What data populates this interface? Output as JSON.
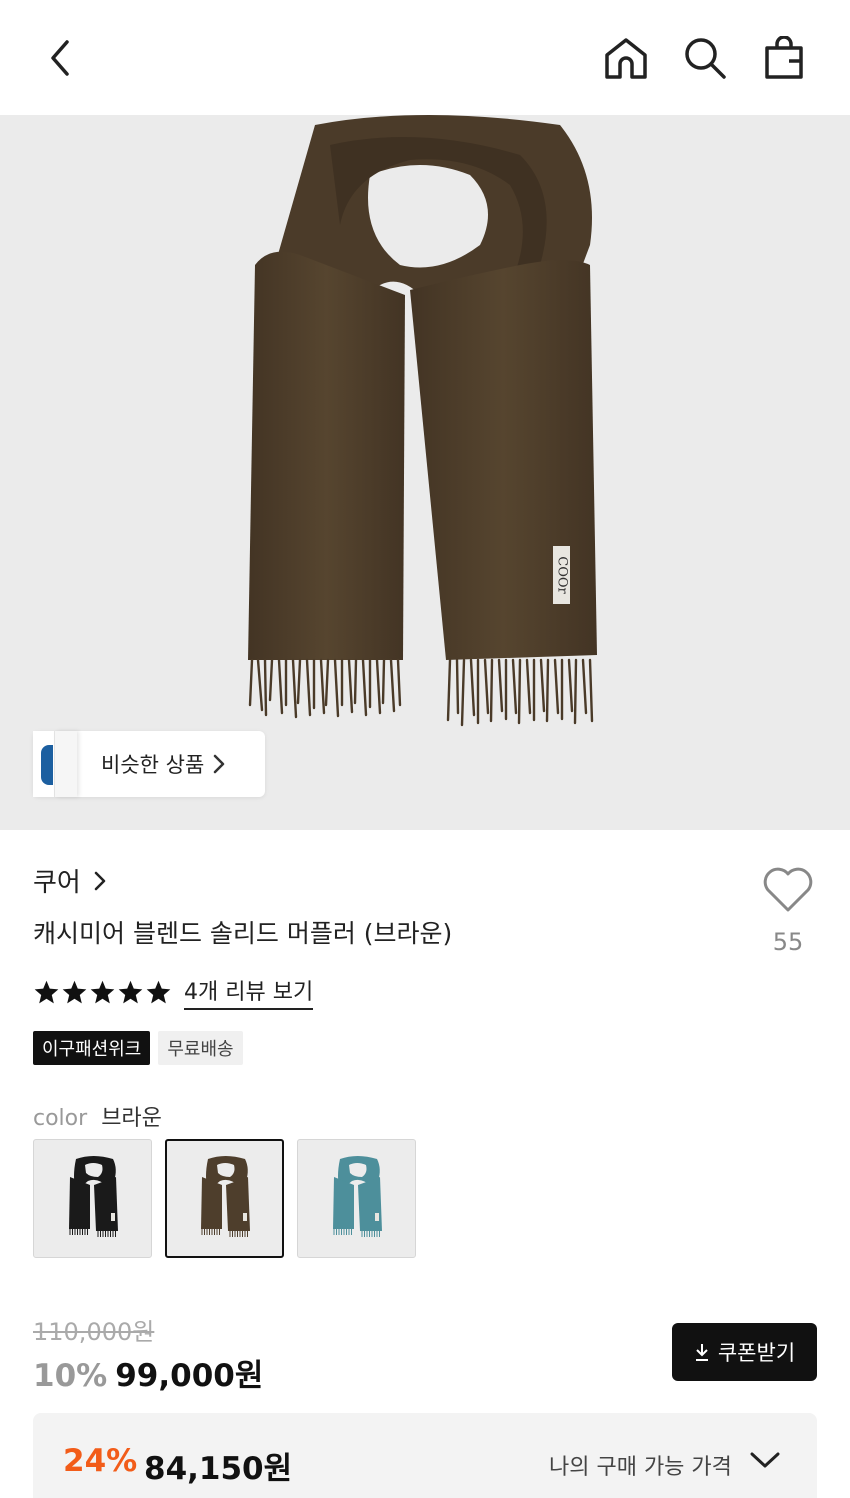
{
  "header": {
    "back_icon": "chevron-left-icon",
    "home_icon": "home-icon",
    "search_icon": "search-icon",
    "bag_icon": "shopping-bag-icon"
  },
  "hero": {
    "similar_label": "비슷한 상품",
    "tag_text": "COOr"
  },
  "product": {
    "brand": "쿠어",
    "title": "캐시미어 블렌드 솔리드 머플러 (브라운)",
    "likes": "55",
    "rating": 5,
    "review_link": "4개 리뷰 보기",
    "badges": [
      "이구패션위크",
      "무료배송"
    ]
  },
  "options": {
    "color_label": "color",
    "selected_color": "브라운",
    "swatch_colors": [
      "#1a1a1a",
      "#4e3e2c",
      "#4d8f9b"
    ],
    "selected_index": 1
  },
  "pricing": {
    "original": "110,000원",
    "discount_pct": "10%",
    "sale_price": "99,000원",
    "coupon_label": "쿠폰받기",
    "my_pct": "24%",
    "my_price": "84,150원",
    "my_price_label": "나의 구매 가능 가격"
  },
  "colors": {
    "accent_orange": "#f25c19",
    "scarf_brown": "#4e3e2c",
    "hero_bg": "#ebebeb"
  }
}
